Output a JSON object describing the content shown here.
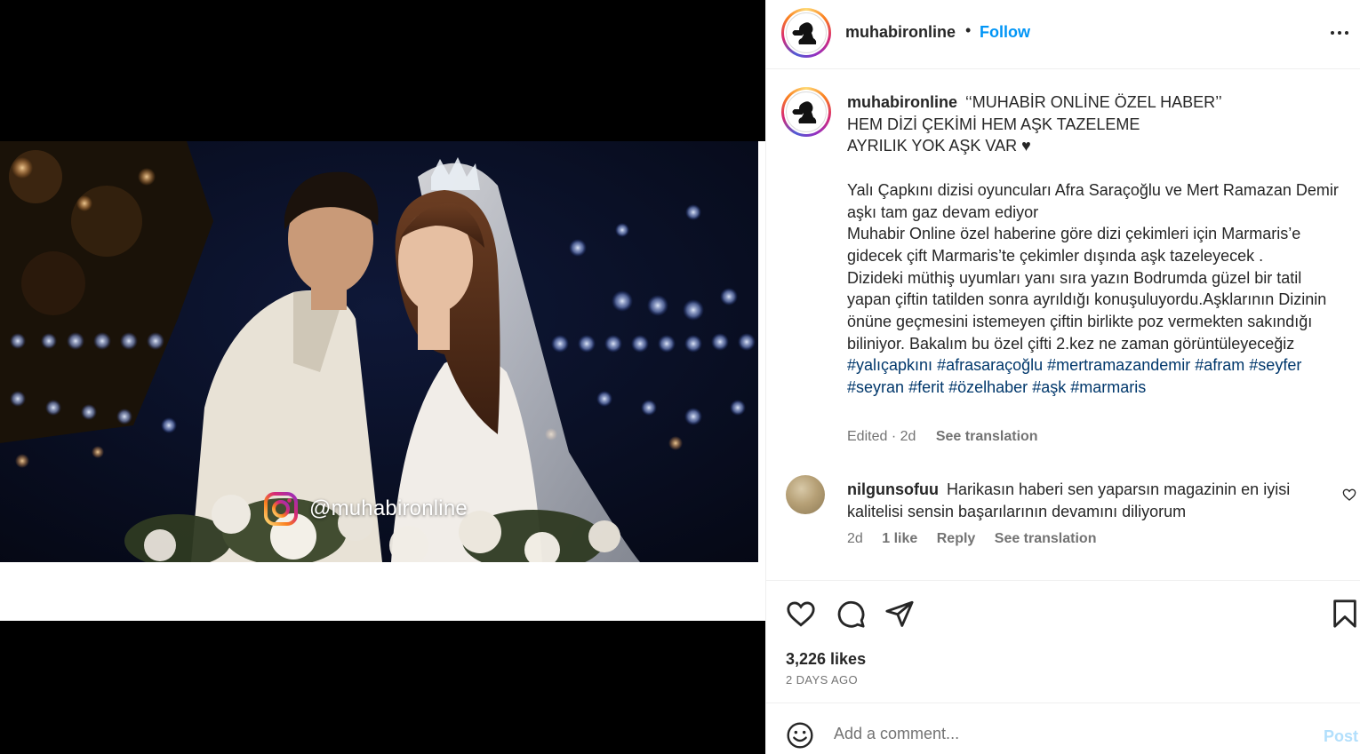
{
  "media": {
    "watermark_text": "@muhabironline"
  },
  "header": {
    "username": "muhabironline",
    "separator": "•",
    "follow_label": "Follow"
  },
  "caption": {
    "username": "muhabironline",
    "lines": [
      "‘‘MUHABİR ONLİNE ÖZEL HABER’’",
      "HEM DİZİ ÇEKİMİ HEM AŞK TAZELEME",
      "AYRILIK YOK AŞK VAR ♥",
      "",
      "Yalı Çapkını dizisi oyuncuları Afra Saraçoğlu ve Mert Ramazan Demir aşkı tam gaz devam ediyor",
      "Muhabir Online özel haberine göre dizi çekimleri için Marmaris’e gidecek çift Marmaris’te çekimler dışında aşk tazeleyecek .",
      "Dizideki müthiş uyumları yanı sıra yazın Bodrumda güzel bir tatil yapan çiftin tatilden sonra ayrıldığı konuşuluyordu.Aşklarının Dizinin önüne geçmesini istemeyen çiftin birlikte poz vermekten sakındığı biliniyor. Bakalım bu özel çifti 2.kez ne zaman görüntüleyeceğiz"
    ],
    "hashtags": [
      "#yalıçapkını",
      "#afrasaraçoğlu",
      "#mertramazandemir",
      "#afram",
      "#seyfer",
      "#seyran",
      "#ferit",
      "#özelhaber",
      "#aşk",
      "#marmaris"
    ],
    "edited_label": "Edited",
    "meta_separator": "·",
    "age": "2d",
    "see_translation": "See translation"
  },
  "comment": {
    "username": "nilgunsofuu",
    "text": "Harikasın haberi sen yaparsın magazinin en iyisi kalitelisi sensin başarılarının devamını diliyorum",
    "age": "2d",
    "likes": "1 like",
    "reply_label": "Reply",
    "see_translation": "See translation"
  },
  "actions": {
    "like_icon": "heart-icon",
    "comment_icon": "comment-bubble-icon",
    "share_icon": "paper-plane-icon",
    "save_icon": "bookmark-icon"
  },
  "likes_text": "3,226 likes",
  "posted_ago": "2 DAYS AGO",
  "comment_box": {
    "placeholder": "Add a comment...",
    "post_label": "Post"
  },
  "colors": {
    "link_blue": "#0095f6",
    "hashtag": "#00376b",
    "muted": "#737373",
    "post_disabled": "#b2dffc"
  }
}
